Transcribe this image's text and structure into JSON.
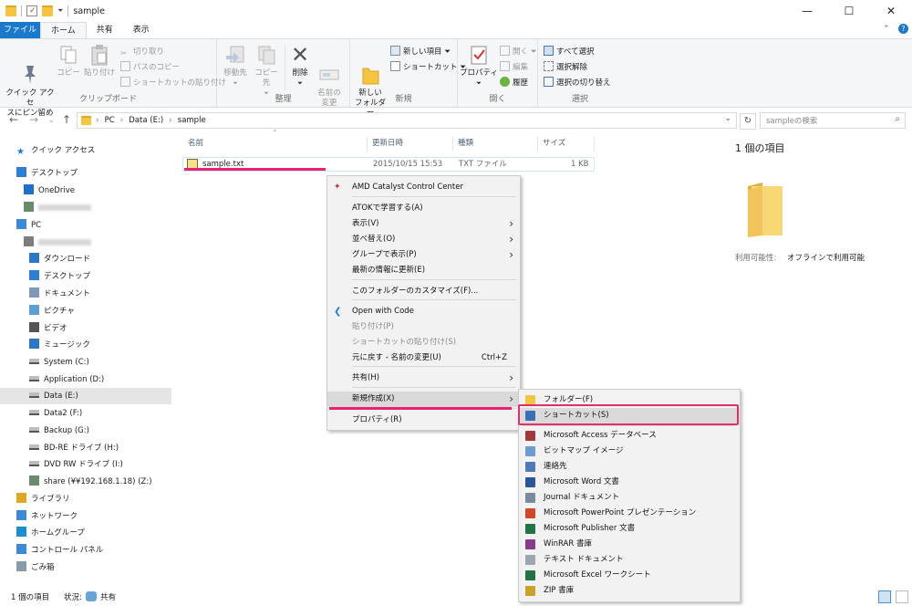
{
  "window": {
    "title": "sample",
    "controls": {
      "minimize": "—",
      "maximize": "☐",
      "close": "✕"
    }
  },
  "tabs": [
    {
      "label": "ファイル"
    },
    {
      "label": "ホーム"
    },
    {
      "label": "共有"
    },
    {
      "label": "表示"
    }
  ],
  "ribbon": {
    "clipboard": {
      "group": "クリップボード",
      "pin": "クイック アクセ\nスにピン留め",
      "copy": "コピー",
      "paste": "貼り付け",
      "cut": "切り取り",
      "copy_path": "パスのコピー",
      "paste_shortcut": "ショートカットの貼り付け"
    },
    "organize": {
      "group": "整理",
      "move": "移動先",
      "copy_to": "コピー先",
      "delete": "削除",
      "rename": "名前の\n変更"
    },
    "new": {
      "group": "新規",
      "new_folder": "新しい\nフォルダー",
      "new_item": "新しい項目",
      "easy_access": "ショートカット"
    },
    "open": {
      "group": "開く",
      "properties": "プロパティ",
      "open": "開く",
      "edit": "編集",
      "history": "履歴"
    },
    "select": {
      "group": "選択",
      "select_all": "すべて選択",
      "select_none": "選択解除",
      "invert": "選択の切り替え"
    }
  },
  "address": {
    "crumbs": [
      "PC",
      "Data (E:)",
      "sample"
    ],
    "search_placeholder": "sampleの検索"
  },
  "nav": [
    {
      "label": "クイック アクセス",
      "icon": "star-icon"
    },
    {
      "label": "デスクトップ",
      "icon": "desktop-icon"
    },
    {
      "label": "OneDrive",
      "icon": "cloud-icon"
    },
    {
      "label": "",
      "icon": "user-icon",
      "blurred": true
    },
    {
      "label": "PC",
      "icon": "pc-icon"
    },
    {
      "label": "",
      "icon": "phone-icon",
      "blurred": true
    },
    {
      "label": "ダウンロード",
      "icon": "download-icon"
    },
    {
      "label": "デスクトップ",
      "icon": "desktop-icon"
    },
    {
      "label": "ドキュメント",
      "icon": "document-icon"
    },
    {
      "label": "ピクチャ",
      "icon": "picture-icon"
    },
    {
      "label": "ビデオ",
      "icon": "video-icon"
    },
    {
      "label": "ミュージック",
      "icon": "music-icon"
    },
    {
      "label": "System (C:)",
      "icon": "drive-icon"
    },
    {
      "label": "Application (D:)",
      "icon": "drive-icon"
    },
    {
      "label": "Data (E:)",
      "icon": "drive-icon",
      "selected": true
    },
    {
      "label": "Data2 (F:)",
      "icon": "drive-icon"
    },
    {
      "label": "Backup (G:)",
      "icon": "drive-icon"
    },
    {
      "label": "BD-RE ドライブ (H:)",
      "icon": "disc-icon"
    },
    {
      "label": "DVD RW ドライブ (I:)",
      "icon": "disc-icon"
    },
    {
      "label": "share (¥¥192.168.1.18) (Z:)",
      "icon": "network-drive-icon"
    },
    {
      "label": "ライブラリ",
      "icon": "library-icon"
    },
    {
      "label": "ネットワーク",
      "icon": "network-icon"
    },
    {
      "label": "ホームグループ",
      "icon": "homegroup-icon"
    },
    {
      "label": "コントロール パネル",
      "icon": "control-panel-icon"
    },
    {
      "label": "ごみ箱",
      "icon": "recycle-bin-icon"
    }
  ],
  "columns": {
    "name": "名前",
    "date": "更新日時",
    "type": "種類",
    "size": "サイズ"
  },
  "file": {
    "name": "sample.txt",
    "date": "2015/10/15 15:53",
    "type": "TXT ファイル",
    "size": "1 KB"
  },
  "details": {
    "count": "1 個の項目",
    "availability_label": "利用可能性:",
    "availability_value": "オフラインで利用可能"
  },
  "context_menu": [
    {
      "label": "AMD Catalyst Control Center"
    },
    {
      "label": "ATOKで学習する(A)"
    },
    {
      "label": "表示(V)",
      "arrow": true
    },
    {
      "label": "並べ替え(O)",
      "arrow": true
    },
    {
      "label": "グループで表示(P)",
      "arrow": true
    },
    {
      "label": "最新の情報に更新(E)"
    },
    {
      "label": "このフォルダーのカスタマイズ(F)..."
    },
    {
      "label": "Open with Code"
    },
    {
      "label": "貼り付け(P)",
      "disabled": true
    },
    {
      "label": "ショートカットの貼り付け(S)",
      "disabled": true
    },
    {
      "label": "元に戻す - 名前の変更(U)",
      "shortcut": "Ctrl+Z"
    },
    {
      "label": "共有(H)",
      "arrow": true
    },
    {
      "label": "新規作成(X)",
      "arrow": true
    },
    {
      "label": "プロパティ(R)"
    }
  ],
  "submenu": [
    {
      "label": "フォルダー(F)"
    },
    {
      "label": "ショートカット(S)"
    },
    {
      "label": "Microsoft Access データベース"
    },
    {
      "label": "ビットマップ イメージ"
    },
    {
      "label": "連絡先"
    },
    {
      "label": "Microsoft Word 文書"
    },
    {
      "label": "Journal ドキュメント"
    },
    {
      "label": "Microsoft PowerPoint プレゼンテーション"
    },
    {
      "label": "Microsoft Publisher 文書"
    },
    {
      "label": "WinRAR 書庫"
    },
    {
      "label": "テキスト ドキュメント"
    },
    {
      "label": "Microsoft Excel ワークシート"
    },
    {
      "label": "ZIP 書庫"
    }
  ],
  "status": {
    "count": "1 個の項目",
    "state_label": "状況:",
    "state_value": "共有"
  },
  "colors": {
    "accent": "#1979ca",
    "highlight": "#e8246e",
    "folder": "#f5c542"
  }
}
